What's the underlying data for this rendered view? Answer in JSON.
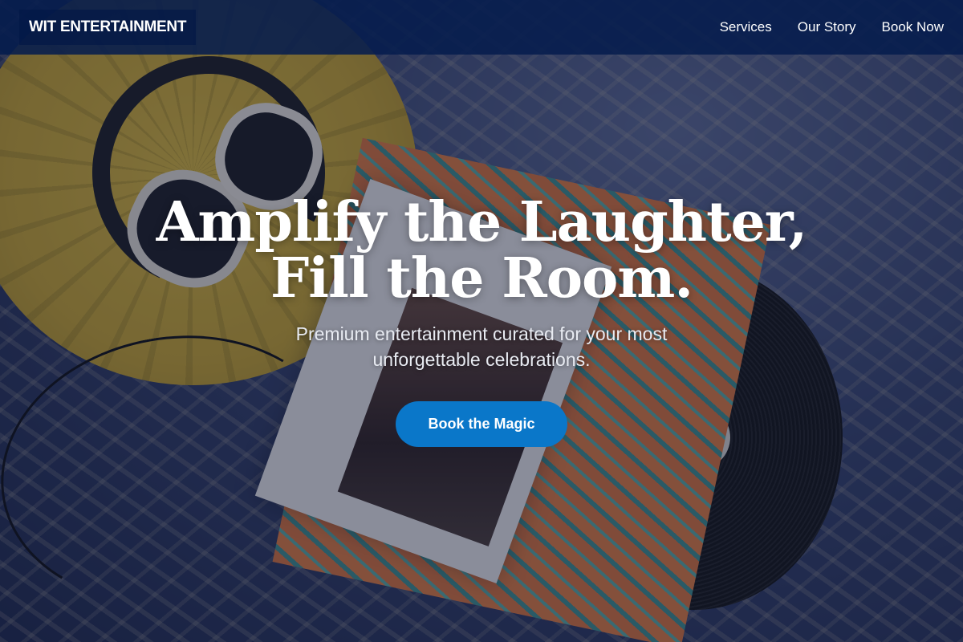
{
  "nav": {
    "brand": "WIT ENTERTAINMENT",
    "links": [
      "Services",
      "Our Story",
      "Book Now"
    ]
  },
  "hero": {
    "title_line1": "Amplify the Laughter,",
    "title_line2": "Fill the Room.",
    "subtitle": "Premium entertainment curated for your most unforgettable celebrations.",
    "cta_label": "Book the Magic"
  },
  "colors": {
    "nav_background": "#061d4d",
    "cta_background": "#0a77c9",
    "text": "#ffffff"
  }
}
